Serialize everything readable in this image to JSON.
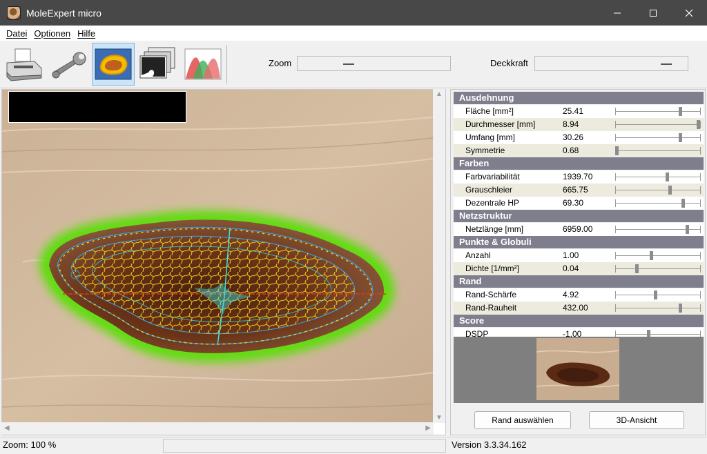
{
  "window": {
    "title": "MoleExpert micro"
  },
  "menu": {
    "items": [
      "Datei",
      "Optionen",
      "Hilfe"
    ]
  },
  "toolbar": {
    "tools": [
      "printer-icon",
      "wrench-icon",
      "lesion-outline-icon",
      "image-stack-icon",
      "histogram-icon"
    ],
    "zoom_label": "Zoom",
    "opacity_label": "Deckkraft"
  },
  "sections": [
    {
      "title": "Ausdehnung",
      "rows": [
        {
          "label": "Fläche [mm²]",
          "value": "25.41",
          "level": 0.77
        },
        {
          "label": "Durchmesser [mm]",
          "value": "8.94",
          "level": 0.99
        },
        {
          "label": "Umfang [mm]",
          "value": "30.26",
          "level": 0.77
        },
        {
          "label": "Symmetrie",
          "value": "0.68",
          "level": 0.0
        }
      ]
    },
    {
      "title": "Farben",
      "rows": [
        {
          "label": "Farbvariabilität",
          "value": "1939.70",
          "level": 0.61
        },
        {
          "label": "Grauschleier",
          "value": "665.75",
          "level": 0.65
        },
        {
          "label": "Dezentrale HP",
          "value": "69.30",
          "level": 0.81
        }
      ]
    },
    {
      "title": "Netzstruktur",
      "rows": [
        {
          "label": "Netzlänge [mm]",
          "value": "6959.00",
          "level": 0.86
        }
      ]
    },
    {
      "title": "Punkte & Globuli",
      "rows": [
        {
          "label": "Anzahl",
          "value": "1.00",
          "level": 0.42
        },
        {
          "label": "Dichte [1/mm²]",
          "value": "0.04",
          "level": 0.24
        }
      ]
    },
    {
      "title": "Rand",
      "rows": [
        {
          "label": "Rand-Schärfe",
          "value": "4.92",
          "level": 0.47
        },
        {
          "label": "Rand-Rauheit",
          "value": "432.00",
          "level": 0.77
        }
      ]
    },
    {
      "title": "Score",
      "rows": [
        {
          "label": "DSDP",
          "value": "-1.00",
          "level": 0.39
        }
      ]
    }
  ],
  "buttons": {
    "select_border": "Rand auswählen",
    "view_3d": "3D-Ansicht"
  },
  "status": {
    "zoom": "Zoom: 100 %",
    "version": "Version 3.3.34.162"
  },
  "colors": {
    "titlebar": "#484848",
    "section_header": "#7e7e8c",
    "row_alt": "#ecebde",
    "contour_glow": "#55e000",
    "contour_lines": "#f2d21b"
  }
}
